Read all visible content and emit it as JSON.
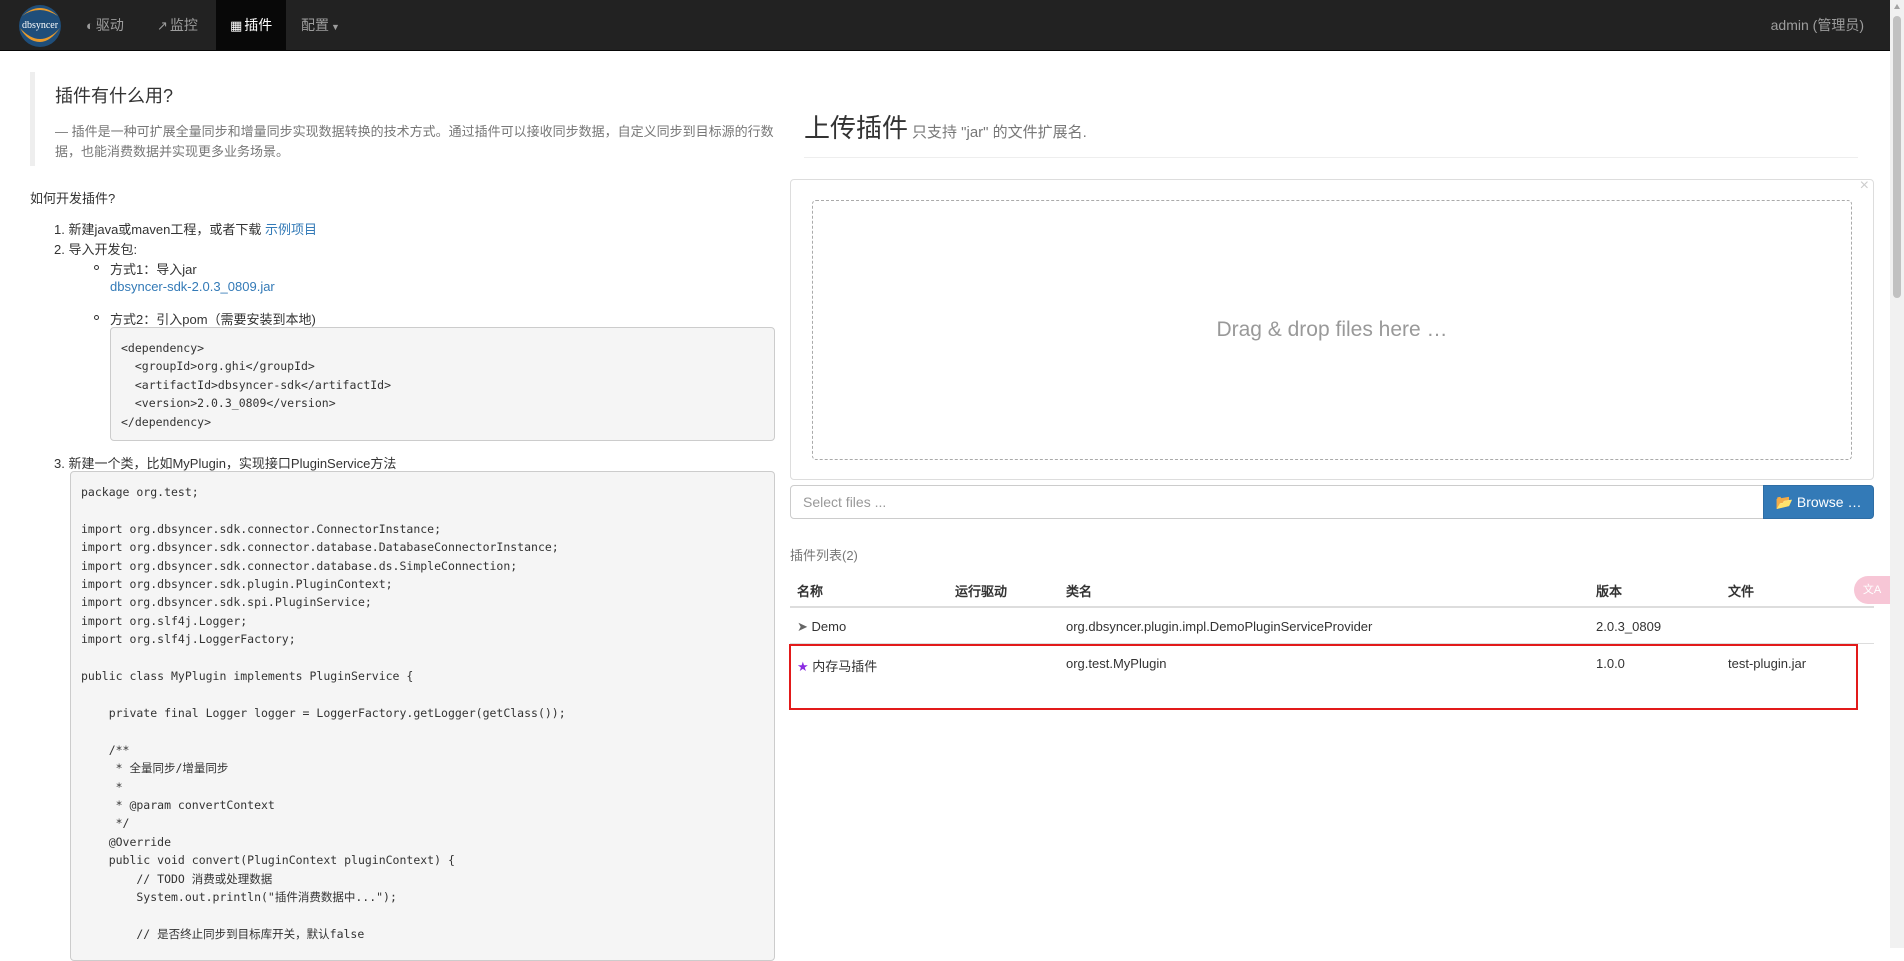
{
  "navbar": {
    "logo_text": "dbsyncer",
    "items": [
      {
        "icon": "dashboard-icon",
        "label": "驱动"
      },
      {
        "icon": "line-chart-icon",
        "label": "监控"
      },
      {
        "icon": "puzzle-icon",
        "label": "插件"
      },
      {
        "icon": "",
        "label": "配置"
      }
    ],
    "user": "admin (管理员)"
  },
  "intro": {
    "title": "插件有什么用?",
    "text": "— 插件是一种可扩展全量同步和增量同步实现数据转换的技术方式。通过插件可以接收同步数据，自定义同步到目标源的行数据，也能消费数据并实现更多业务场景。"
  },
  "howto": {
    "title": "如何开发插件?",
    "step1": "1. 新建java或maven工程，或者下载 ",
    "step1_link": "示例项目",
    "step2": "2. 导入开发包:",
    "method1": "方式1：导入jar",
    "method1_link": "dbsyncer-sdk-2.0.3_0809.jar",
    "method2": "方式2：引入pom（需要安装到本地)",
    "pom": "<dependency>\n  <groupId>org.ghi</groupId>\n  <artifactId>dbsyncer-sdk</artifactId>\n  <version>2.0.3_0809</version>\n</dependency>",
    "step3": "3. 新建一个类，比如MyPlugin，实现接口PluginService方法",
    "code": "package org.test;\n\nimport org.dbsyncer.sdk.connector.ConnectorInstance;\nimport org.dbsyncer.sdk.connector.database.DatabaseConnectorInstance;\nimport org.dbsyncer.sdk.connector.database.ds.SimpleConnection;\nimport org.dbsyncer.sdk.plugin.PluginContext;\nimport org.dbsyncer.sdk.spi.PluginService;\nimport org.slf4j.Logger;\nimport org.slf4j.LoggerFactory;\n\npublic class MyPlugin implements PluginService {\n\n    private final Logger logger = LoggerFactory.getLogger(getClass());\n\n    /**\n     * 全量同步/增量同步\n     *\n     * @param convertContext\n     */\n    @Override\n    public void convert(PluginContext pluginContext) {\n        // TODO 消费或处理数据\n        System.out.println(\"插件消费数据中...\");\n\n        // 是否终止同步到目标库开关，默认false"
  },
  "upload": {
    "title": "上传插件",
    "subtitle": "只支持 \"jar\" 的文件扩展名.",
    "drop_text": "Drag & drop files here …",
    "close": "×",
    "placeholder": "Select files ...",
    "browse": "Browse …"
  },
  "plugins": {
    "count_label": "插件列表(2)",
    "headers": [
      "名称",
      "运行驱动",
      "类名",
      "版本",
      "文件"
    ],
    "rows": [
      {
        "icon": "plug-icon",
        "name": "Demo",
        "driver": "",
        "class": "org.dbsyncer.plugin.impl.DemoPluginServiceProvider",
        "version": "2.0.3_0809",
        "file": ""
      },
      {
        "icon": "star-icon",
        "name": "内存马插件",
        "driver": "",
        "class": "org.test.MyPlugin",
        "version": "1.0.0",
        "file": "test-plugin.jar"
      }
    ]
  },
  "floating": {
    "label": "文A"
  },
  "colors": {
    "navbar": "#222222",
    "link": "#337ab7",
    "highlight": "#e21a1a",
    "star": "#8a2be2"
  }
}
